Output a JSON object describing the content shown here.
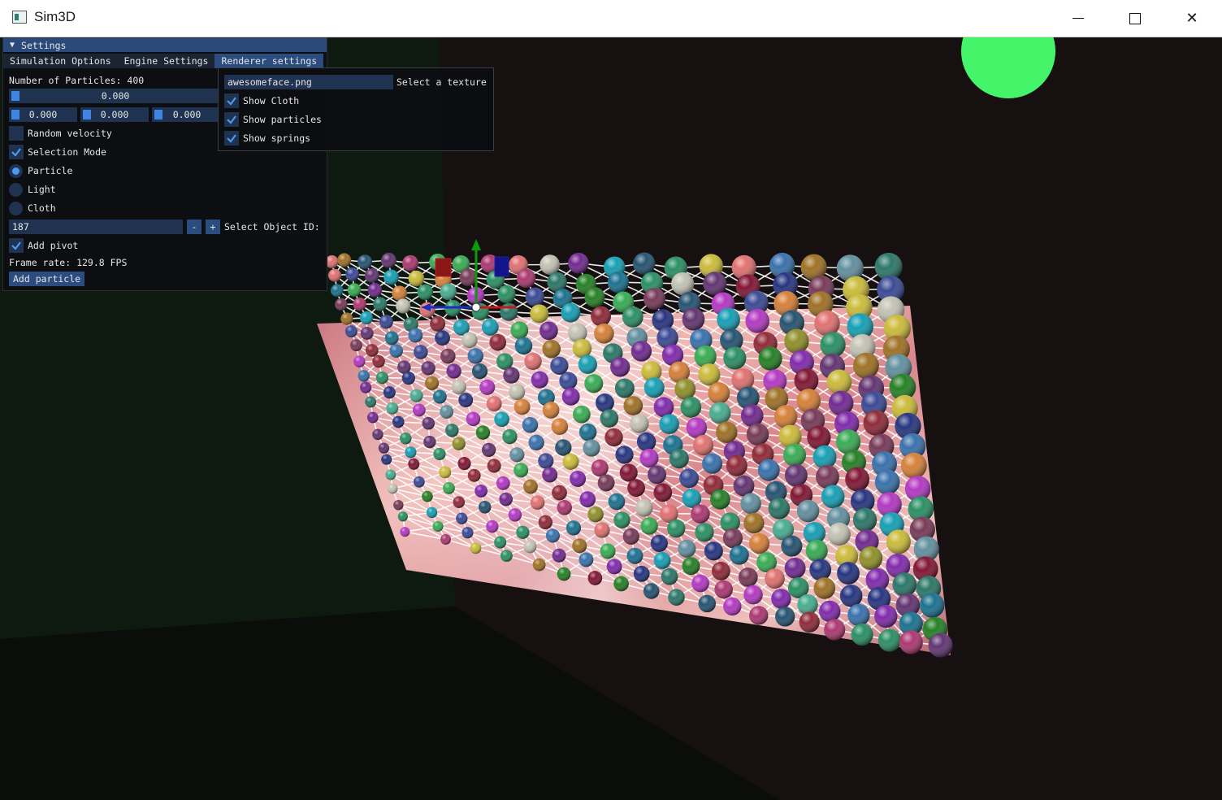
{
  "window": {
    "title": "Sim3D",
    "minimize_glyph": "—",
    "close_glyph": "✕"
  },
  "settings": {
    "header": "Settings",
    "collapse_glyph": "▼",
    "tabs": [
      "Simulation Options",
      "Engine Settings",
      "Renderer settings"
    ],
    "active_tab": "Renderer settings",
    "particle_count_text": "Number of Particles: 400",
    "slider_main": "0.000",
    "vec_x": "0.000",
    "vec_y": "0.000",
    "vec_z": "0.000",
    "random_velocity": {
      "label": "Random velocity",
      "checked": false
    },
    "selection_mode": {
      "label": "Selection Mode",
      "checked": true
    },
    "modes": [
      {
        "label": "Particle",
        "selected": true
      },
      {
        "label": "Light",
        "selected": false
      },
      {
        "label": "Cloth",
        "selected": false
      }
    ],
    "object_id_value": "187",
    "minus": "-",
    "plus": "+",
    "object_id_label": "Select Object ID:",
    "add_pivot": {
      "label": "Add pivot",
      "checked": true
    },
    "frame_rate_text": "Frame rate: 129.8 FPS",
    "add_particle_label": "Add particle"
  },
  "renderer_popup": {
    "texture_value": "awesomeface.png",
    "texture_label": "Select a texture",
    "show_cloth": {
      "label": "Show Cloth",
      "checked": true
    },
    "show_particles": {
      "label": "Show particles",
      "checked": true
    },
    "show_springs": {
      "label": "Show springs",
      "checked": true
    }
  },
  "colors": {
    "accent": "#2b4c7e",
    "frame": "#1f3250",
    "check": "#4a9bf0",
    "light_sphere": "#44f56a"
  }
}
